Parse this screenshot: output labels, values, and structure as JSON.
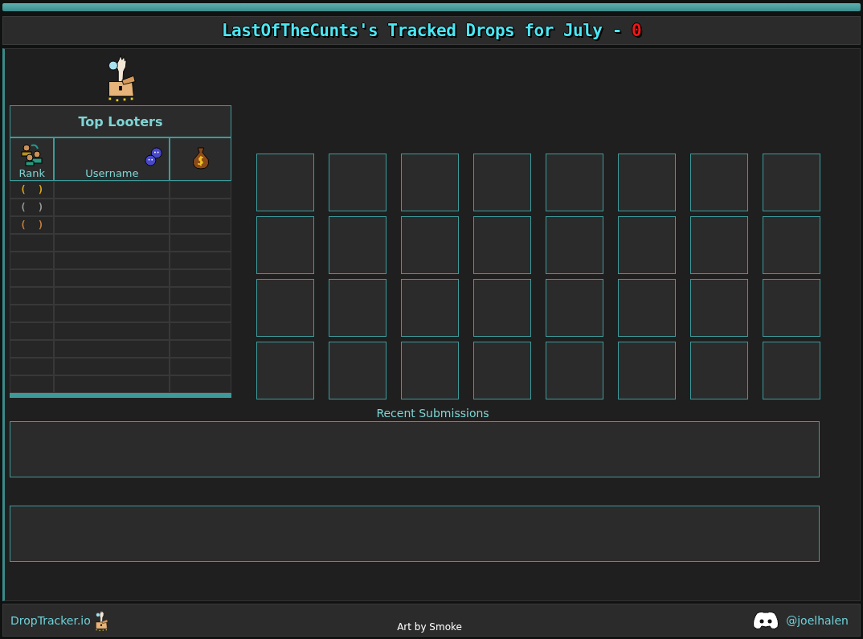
{
  "title": {
    "text": "LastOfTheCunts's Tracked Drops for July - ",
    "count": "0"
  },
  "top_looters": {
    "title": "Top Looters",
    "columns": [
      {
        "kind": "rank",
        "label": "Rank"
      },
      {
        "kind": "username",
        "label": "Username"
      },
      {
        "kind": "loot"
      }
    ],
    "rows": [
      {
        "kind": "ranked",
        "rank": "(  )",
        "color": "#e0a91e"
      },
      {
        "kind": "ranked",
        "rank": "(  )",
        "color": "#9c9c9c"
      },
      {
        "kind": "ranked",
        "rank": "(  )",
        "color": "#c8803e"
      },
      {
        "kind": "empty"
      },
      {
        "kind": "empty"
      },
      {
        "kind": "empty"
      },
      {
        "kind": "empty"
      },
      {
        "kind": "empty"
      },
      {
        "kind": "empty"
      },
      {
        "kind": "empty"
      },
      {
        "kind": "empty"
      },
      {
        "kind": "empty"
      }
    ]
  },
  "drop_slots": [
    {
      "kind": "empty"
    },
    {
      "kind": "empty"
    },
    {
      "kind": "empty"
    },
    {
      "kind": "empty"
    },
    {
      "kind": "empty"
    },
    {
      "kind": "empty"
    },
    {
      "kind": "empty"
    },
    {
      "kind": "empty"
    },
    {
      "kind": "empty"
    },
    {
      "kind": "empty"
    },
    {
      "kind": "empty"
    },
    {
      "kind": "empty"
    },
    {
      "kind": "empty"
    },
    {
      "kind": "empty"
    },
    {
      "kind": "empty"
    },
    {
      "kind": "empty"
    },
    {
      "kind": "empty"
    },
    {
      "kind": "empty"
    },
    {
      "kind": "empty"
    },
    {
      "kind": "empty"
    },
    {
      "kind": "empty"
    },
    {
      "kind": "empty"
    },
    {
      "kind": "empty"
    },
    {
      "kind": "empty"
    },
    {
      "kind": "empty"
    },
    {
      "kind": "empty"
    },
    {
      "kind": "empty"
    },
    {
      "kind": "empty"
    },
    {
      "kind": "empty"
    },
    {
      "kind": "empty"
    },
    {
      "kind": "empty"
    },
    {
      "kind": "empty"
    }
  ],
  "recent_submissions": {
    "title": "Recent Submissions",
    "panels": [
      {
        "kind": "empty"
      },
      {
        "kind": "empty"
      }
    ]
  },
  "footer": {
    "site": "DropTracker.io",
    "credit": "Art by Smoke",
    "handle": "@joelhalen"
  }
}
